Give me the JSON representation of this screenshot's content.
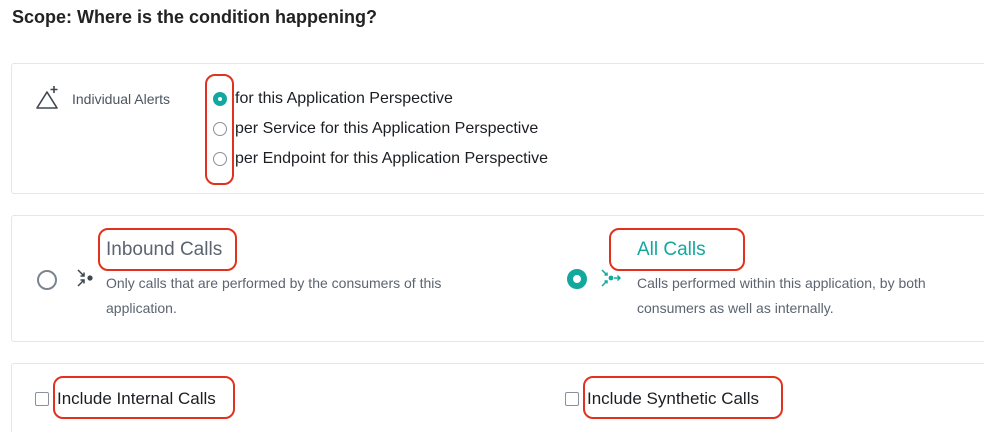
{
  "page": {
    "heading": "Scope: Where is the condition happening?"
  },
  "alerts": {
    "label": "Individual Alerts",
    "icon": "alert-triangle-plus-icon",
    "options": [
      {
        "label": "for this Application Perspective",
        "selected": true
      },
      {
        "label": "per Service for this Application Perspective",
        "selected": false
      },
      {
        "label": "per Endpoint for this Application Perspective",
        "selected": false
      }
    ]
  },
  "calls": {
    "inbound": {
      "title": "Inbound Calls",
      "description": "Only calls that are performed by the consumers of this application.",
      "selected": false,
      "icon": "inbound-calls-icon"
    },
    "all": {
      "title": "All Calls",
      "description": "Calls performed within this application, by both consumers as well as internally.",
      "selected": true,
      "icon": "all-calls-icon"
    }
  },
  "include": {
    "internal": {
      "label": "Include Internal Calls",
      "checked": false
    },
    "synthetic": {
      "label": "Include Synthetic Calls",
      "checked": false
    }
  },
  "colors": {
    "accent": "#13a89e",
    "highlight": "#e0321e",
    "border": "#e3e6ea"
  }
}
